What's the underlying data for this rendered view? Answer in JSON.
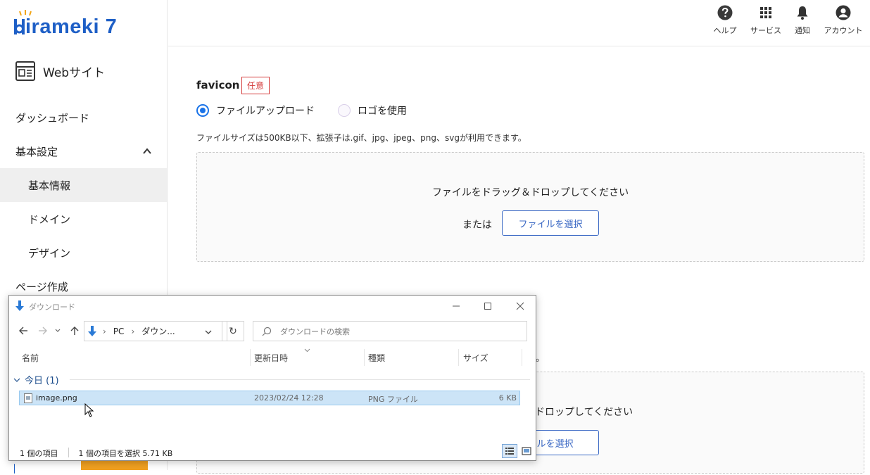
{
  "logo": {
    "text": "irameki 7"
  },
  "site": {
    "label": "Webサイト"
  },
  "sidebar": {
    "items": [
      {
        "label": "ダッシュボード"
      },
      {
        "label": "基本設定"
      },
      {
        "label": "基本情報"
      },
      {
        "label": "ドメイン"
      },
      {
        "label": "デザイン"
      },
      {
        "label": "ページ作成"
      }
    ]
  },
  "header": {
    "help": "ヘルプ",
    "services": "サービス",
    "notify": "通知",
    "account": "アカウント"
  },
  "favicon": {
    "title": "favicon",
    "badge": "任意",
    "option_upload": "ファイルアップロード",
    "option_logo": "ロゴを使用",
    "note": "ファイルサイズは500KB以下、拡張子は.gif、jpg、jpeg、png、svgが利用できます。",
    "drop_text": "ファイルをドラッグ＆ドロップしてください",
    "or": "または",
    "select_button": "ファイルを選択"
  },
  "second": {
    "note_tail": "。",
    "drop_text_tail": "ドロップしてください",
    "select_button_tail": "イルを選択"
  },
  "explorer": {
    "title": "ダウンロード",
    "path_pc": "PC",
    "path_folder": "ダウン...",
    "search_placeholder": "ダウンロードの検索",
    "columns": [
      "名前",
      "更新日時",
      "種類",
      "サイズ"
    ],
    "group": "今日 (1)",
    "file": {
      "name": "image.png",
      "date": "2023/02/24 12:28",
      "type": "PNG ファイル",
      "size": "6 KB"
    },
    "status_count": "1 個の項目",
    "status_selected": "1 個の項目を選択  5.71 KB"
  },
  "colors": {
    "brand": "#1e5fc6",
    "accent": "#1a73e8",
    "badge": "#d43a3a",
    "selection": "#cce4f7"
  }
}
